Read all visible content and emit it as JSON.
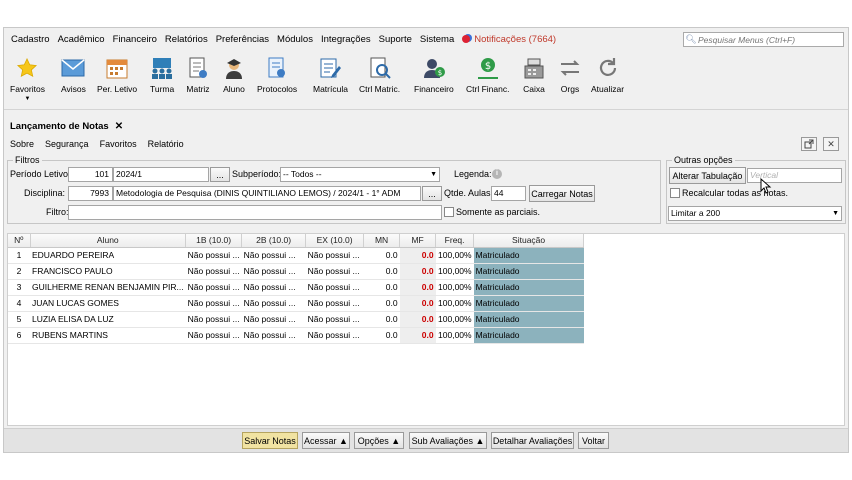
{
  "menu": {
    "items": [
      "Cadastro",
      "Acadêmico",
      "Financeiro",
      "Relatórios",
      "Preferências",
      "Módulos",
      "Integrações",
      "Suporte",
      "Sistema"
    ],
    "notifications": "Notificações (7664)",
    "search_placeholder": "Pesquisar Menus (Ctrl+F)"
  },
  "toolbar": {
    "buttons": [
      {
        "label": "Favoritos",
        "icon": "star-icon"
      },
      {
        "label": "Avisos",
        "icon": "envelope-icon"
      },
      {
        "label": "Per. Letivo",
        "icon": "calendar-icon"
      },
      {
        "label": "Turma",
        "icon": "class-icon"
      },
      {
        "label": "Matriz",
        "icon": "document-icon"
      },
      {
        "label": "Aluno",
        "icon": "student-icon"
      },
      {
        "label": "Protocolos",
        "icon": "protocol-icon"
      },
      {
        "label": "Matrícula",
        "icon": "enrollment-icon"
      },
      {
        "label": "Ctrl Matric.",
        "icon": "search-document-icon"
      },
      {
        "label": "Financeiro",
        "icon": "finance-user-icon"
      },
      {
        "label": "Ctrl Financ.",
        "icon": "money-hand-icon"
      },
      {
        "label": "Caixa",
        "icon": "cash-register-icon"
      },
      {
        "label": "Orgs",
        "icon": "arrows-icon"
      },
      {
        "label": "Atualizar",
        "icon": "refresh-icon"
      }
    ]
  },
  "tab": {
    "title": "Lançamento de Notas",
    "close": "✕"
  },
  "submenu": [
    "Sobre",
    "Segurança",
    "Favoritos",
    "Relatório"
  ],
  "filters": {
    "title": "Filtros",
    "periodo_label": "Período Letivo:",
    "periodo_code": "101",
    "periodo_value": "2024/1",
    "subperiodo_label": "Subperíodo:",
    "subperiodo_value": "-- Todos --",
    "legenda_label": "Legenda:",
    "disciplina_label": "Disciplina:",
    "disciplina_code": "7993",
    "disciplina_value": "Metodologia de Pesquisa (DINIS QUINTILIANO LEMOS) / 2024/1 - 1° ADM",
    "qtde_label": "Qtde. Aulas:",
    "qtde_value": "44",
    "carregar_label": "Carregar Notas",
    "filtro_label": "Filtro:",
    "filtro_value": "",
    "parciais_label": "Somente as parciais.",
    "ellipsis": "..."
  },
  "options": {
    "title": "Outras opções",
    "alterar_label": "Alterar Tabulação",
    "vertical_placeholder": "Vertical",
    "recalcular_label": "Recalcular todas as notas.",
    "limitar_value": "Limitar a 200"
  },
  "grid": {
    "columns": [
      "Nº",
      "Aluno",
      "1B (10.0)",
      "2B (10.0)",
      "EX (10.0)",
      "MN",
      "MF",
      "Freq.",
      "Situação"
    ],
    "rows": [
      {
        "n": "1",
        "aluno": "EDUARDO PEREIRA",
        "b1": "Não possui ...",
        "b2": "Não possui ...",
        "ex": "Não possui ...",
        "mn": "0.0",
        "mf": "0.0",
        "freq": "100,00%",
        "sit": "Matriculado"
      },
      {
        "n": "2",
        "aluno": "FRANCISCO PAULO",
        "b1": "Não possui ...",
        "b2": "Não possui ...",
        "ex": "Não possui ...",
        "mn": "0.0",
        "mf": "0.0",
        "freq": "100,00%",
        "sit": "Matriculado"
      },
      {
        "n": "3",
        "aluno": "GUILHERME RENAN BENJAMIN PIR...",
        "b1": "Não possui ...",
        "b2": "Não possui ...",
        "ex": "Não possui ...",
        "mn": "0.0",
        "mf": "0.0",
        "freq": "100,00%",
        "sit": "Matriculado"
      },
      {
        "n": "4",
        "aluno": "JUAN LUCAS GOMES",
        "b1": "Não possui ...",
        "b2": "Não possui ...",
        "ex": "Não possui ...",
        "mn": "0.0",
        "mf": "0.0",
        "freq": "100,00%",
        "sit": "Matriculado"
      },
      {
        "n": "5",
        "aluno": "LUZIA ELISA DA LUZ",
        "b1": "Não possui ...",
        "b2": "Não possui ...",
        "ex": "Não possui ...",
        "mn": "0.0",
        "mf": "0.0",
        "freq": "100,00%",
        "sit": "Matriculado"
      },
      {
        "n": "6",
        "aluno": "RUBENS MARTINS",
        "b1": "Não possui ...",
        "b2": "Não possui ...",
        "ex": "Não possui ...",
        "mn": "0.0",
        "mf": "0.0",
        "freq": "100,00%",
        "sit": "Matriculado"
      }
    ]
  },
  "bottom": {
    "salvar": "Salvar Notas",
    "acessar": "Acessar ▲",
    "opcoes": "Opções ▲",
    "sub": "Sub Avaliações ▲",
    "detalhar": "Detalhar Avaliações",
    "voltar": "Voltar"
  },
  "colors": {
    "situacao_bg": "#8cb2bd",
    "mf_text": "#cc0000",
    "salvar_bg": "#f1e3a2",
    "notif": "#c0392b"
  }
}
